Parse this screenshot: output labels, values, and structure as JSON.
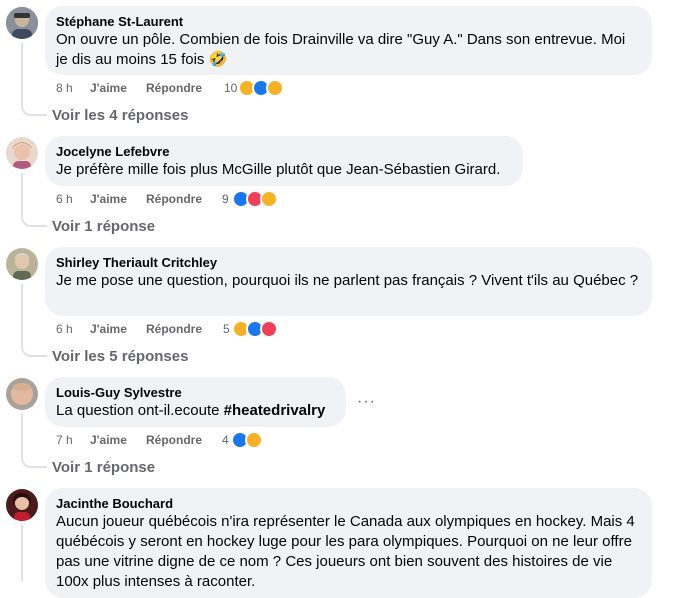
{
  "comments": [
    {
      "author": "Stéphane St-Laurent",
      "text": "On ouvre un pôle. Combien de fois Drainville va dire \"Guy A.\" Dans son entrevue. Moi je dis au moins 15 fois 🤣",
      "time": "8 h",
      "like_label": "J'aime",
      "reply_label": "Répondre",
      "reaction_count": "10",
      "reactions": [
        "haha-icon",
        "like-icon",
        "care-icon"
      ],
      "replies_link": "Voir les 4 réponses"
    },
    {
      "author": "Jocelyne Lefebvre",
      "text": "Je préfère mille fois plus McGille plutôt que Jean-Sébastien Girard.",
      "time": "6 h",
      "like_label": "J'aime",
      "reply_label": "Répondre",
      "reaction_count": "9",
      "reactions": [
        "like-icon",
        "love-icon",
        "care-icon"
      ],
      "replies_link": "Voir 1 réponse"
    },
    {
      "author": "Shirley Theriault Critchley",
      "text": "Je me pose une question, pourquoi ils ne parlent pas français ? Vivent t'ils au Québec ?",
      "time": "6 h",
      "like_label": "J'aime",
      "reply_label": "Répondre",
      "reaction_count": "5",
      "reactions": [
        "haha-icon",
        "like-icon",
        "love-icon"
      ],
      "replies_link": "Voir les 5 réponses"
    },
    {
      "author": "Louis-Guy Sylvestre",
      "text": "La question ont-il.ecoute ",
      "hashtag": "#heatedrivalry",
      "time": "7 h",
      "like_label": "J'aime",
      "reply_label": "Répondre",
      "reaction_count": "4",
      "reactions": [
        "like-icon",
        "care-icon"
      ],
      "replies_link": "Voir 1 réponse",
      "more_label": "···"
    },
    {
      "author": "Jacinthe Bouchard",
      "text": "Aucun joueur québécois n'ira représenter le Canada aux olympiques en hockey. Mais 4 québécois y seront en hockey luge pour les para olympiques. Pourquoi on ne leur offre pas une vitrine digne de ce nom ? Ces joueurs ont bien souvent des histoires de vie 100x plus intenses à raconter."
    }
  ],
  "colors": {
    "bubble": "#f0f2f5",
    "meta_text": "#65676b",
    "like_blue": "#1877f2",
    "love_red": "#f33e58",
    "haha_yellow": "#f7b125"
  }
}
